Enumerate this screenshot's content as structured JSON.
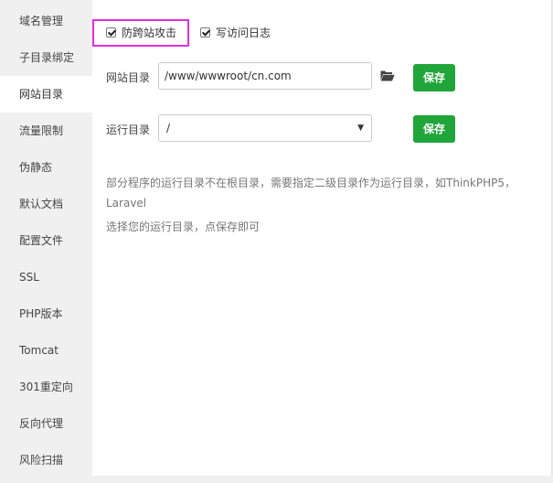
{
  "sidebar": {
    "items": [
      {
        "label": "域名管理",
        "active": false
      },
      {
        "label": "子目录绑定",
        "active": false
      },
      {
        "label": "网站目录",
        "active": true
      },
      {
        "label": "流量限制",
        "active": false
      },
      {
        "label": "伪静态",
        "active": false
      },
      {
        "label": "默认文档",
        "active": false
      },
      {
        "label": "配置文件",
        "active": false
      },
      {
        "label": "SSL",
        "active": false
      },
      {
        "label": "PHP版本",
        "active": false
      },
      {
        "label": "Tomcat",
        "active": false
      },
      {
        "label": "301重定向",
        "active": false
      },
      {
        "label": "反向代理",
        "active": false
      },
      {
        "label": "风险扫描",
        "active": false
      }
    ]
  },
  "options": {
    "anti_xss": {
      "label": "防跨站攻击",
      "checked": true
    },
    "access_log": {
      "label": "写访问日志",
      "checked": true
    }
  },
  "site_dir": {
    "label": "网站目录",
    "value": "/www/wwwroot/cn.com",
    "folder_icon": "folder-open-icon",
    "save_label": "保存"
  },
  "run_dir": {
    "label": "运行目录",
    "selected": "/",
    "save_label": "保存"
  },
  "help": {
    "line1": "部分程序的运行目录不在根目录，需要指定二级目录作为运行目录，如ThinkPHP5，",
    "line2": "Laravel",
    "line3": "选择您的运行目录，点保存即可"
  },
  "colors": {
    "accent_green": "#20a53a",
    "highlight_magenta": "#e030e0",
    "sidebar_bg": "#f0f0f0"
  }
}
